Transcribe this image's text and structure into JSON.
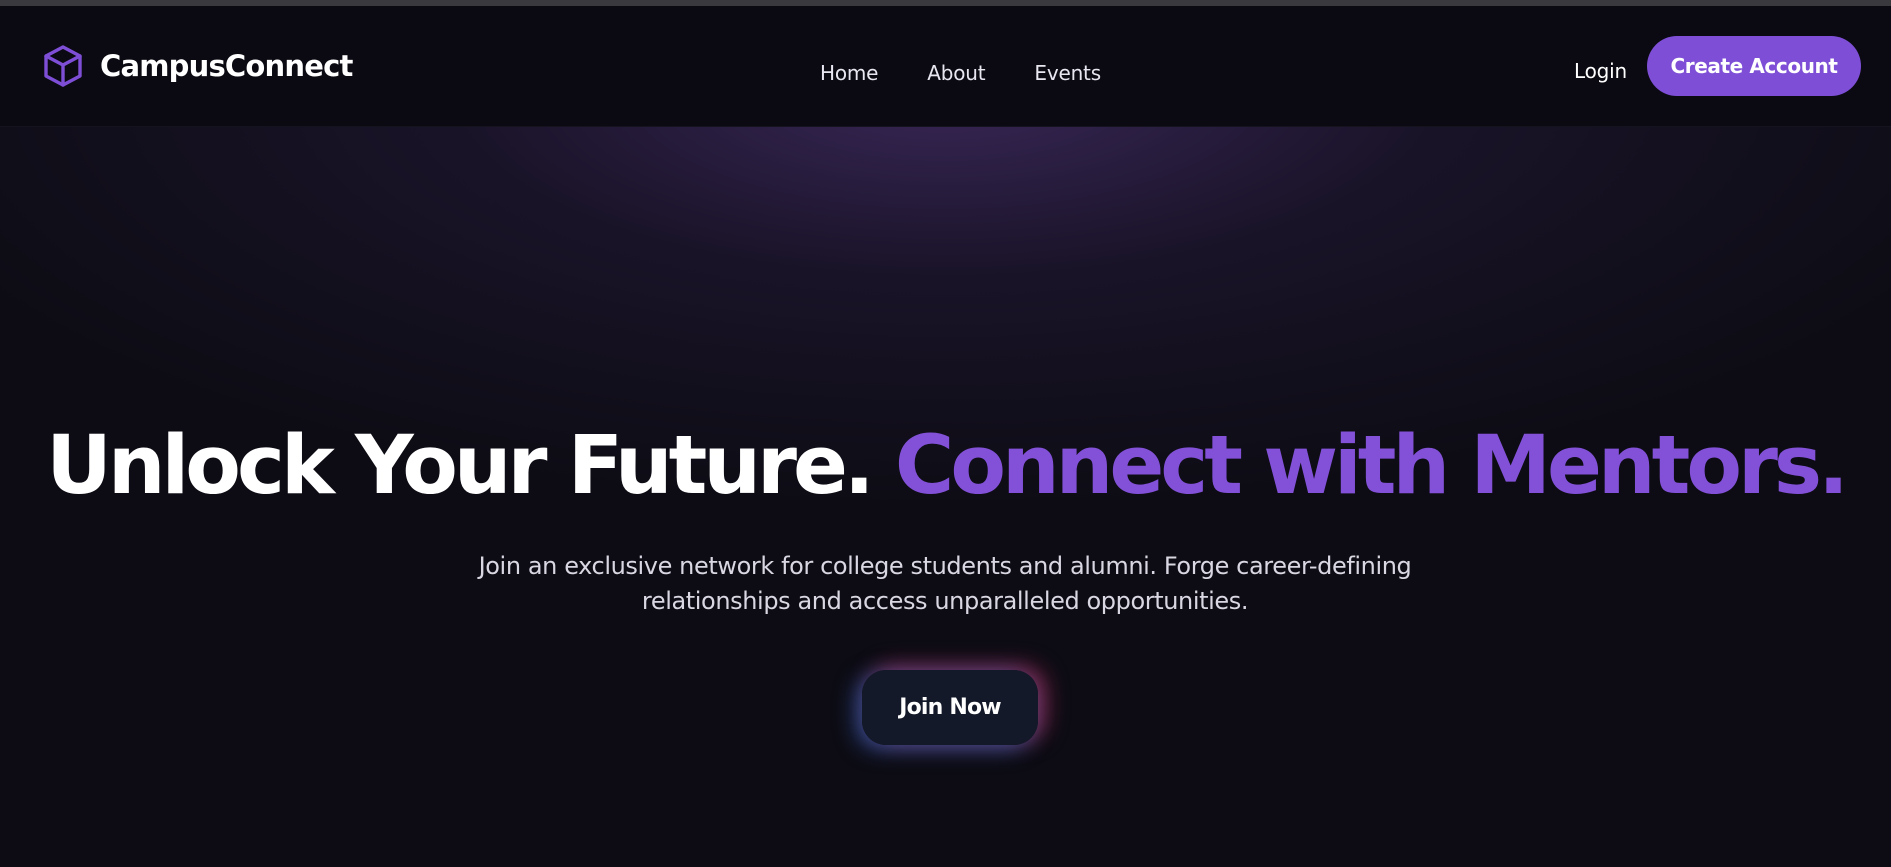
{
  "brand": {
    "name": "CampusConnect",
    "icon": "cube-icon",
    "icon_color": "#7e4fd6"
  },
  "nav": {
    "items": [
      {
        "label": "Home"
      },
      {
        "label": "About"
      },
      {
        "label": "Events"
      }
    ],
    "login_label": "Login",
    "create_account_label": "Create Account"
  },
  "hero": {
    "headline_part1": "Unlock Your Future.",
    "headline_part2": "Connect with Mentors.",
    "subtitle_line1": "Join an exclusive network for college students and alumni. Forge career-defining",
    "subtitle_line2": "relationships and access unparalleled opportunities.",
    "cta_label": "Join Now"
  },
  "colors": {
    "accent": "#7e4fd6",
    "headline_accent": "#8251d8",
    "background": "#0d0c14",
    "navbar": "#0b0a12",
    "cta_background": "#141929"
  }
}
